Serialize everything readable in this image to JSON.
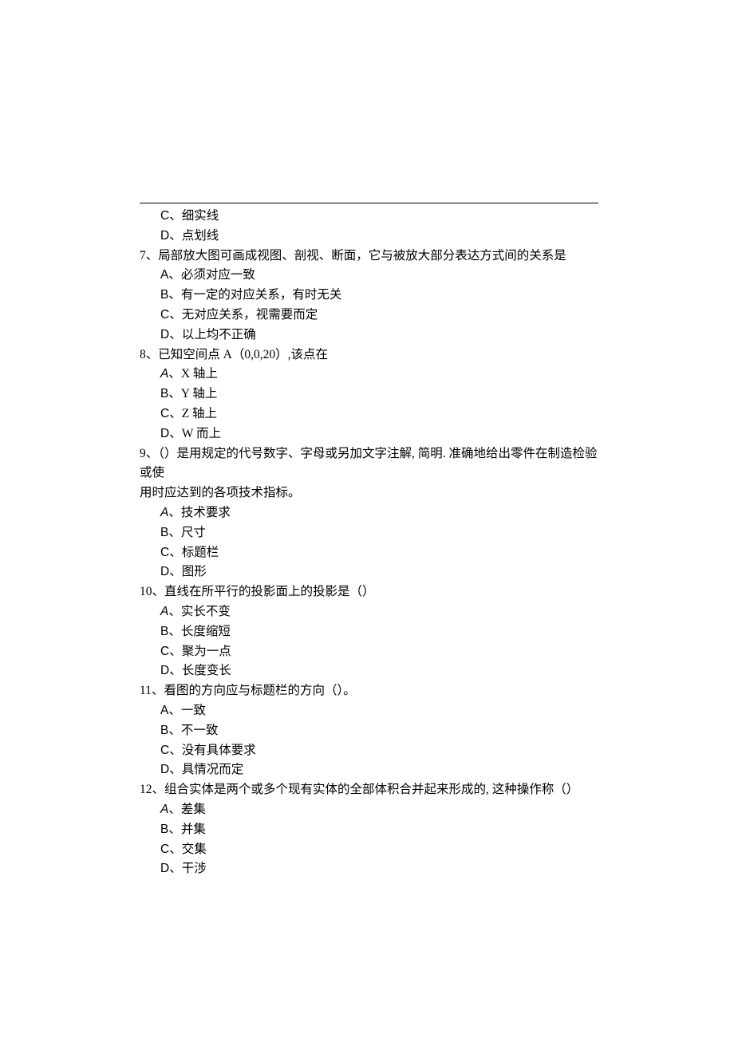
{
  "orphanOptions": {
    "C": "细实线",
    "D": "点划线"
  },
  "questions": [
    {
      "num": "7",
      "stem": "局部放大图可画成视图、剖视、断面，它与被放大部分表达方式间的关系是",
      "opts": {
        "A": "必须对应一致",
        "B": "有一定的对应关系，有时无关",
        "C": "无对应关系，视需要而定",
        "D": "以上均不正确"
      }
    },
    {
      "num": "8",
      "stem": "已知空间点 A（0,0,20）,该点在",
      "opts": {
        "A": "X 轴上",
        "B": "Y 轴上",
        "C": "Z 轴上",
        "D": "W 而上"
      }
    },
    {
      "num": "9",
      "stem": "（）是用规定的代号数字、字母或另加文字注解, 简明. 准确地给出零件在制造检验或使",
      "stem2": "用时应达到的各项技术指标。",
      "opts": {
        "A": "技术要求",
        "B": "尺寸",
        "C": "标题栏",
        "D": "图形"
      }
    },
    {
      "num": "10",
      "stem": "直线在所平行的投影面上的投影是（）",
      "opts": {
        "A": "实长不变",
        "B": "长度缩短",
        "C": "聚为一点",
        "D": "长度变长"
      }
    },
    {
      "num": "11",
      "stem": "看图的方向应与标题栏的方向（）。",
      "opts": {
        "A": "一致",
        "B": "不一致",
        "C": "没有具体要求",
        "D": "具情况而定"
      }
    },
    {
      "num": "12",
      "stem": "组合实体是两个或多个现有实体的全部体积合并起来形成的, 这种操作称（）",
      "opts": {
        "A": "差集",
        "B": "并集",
        "C": "交集",
        "D": "干涉"
      }
    }
  ]
}
